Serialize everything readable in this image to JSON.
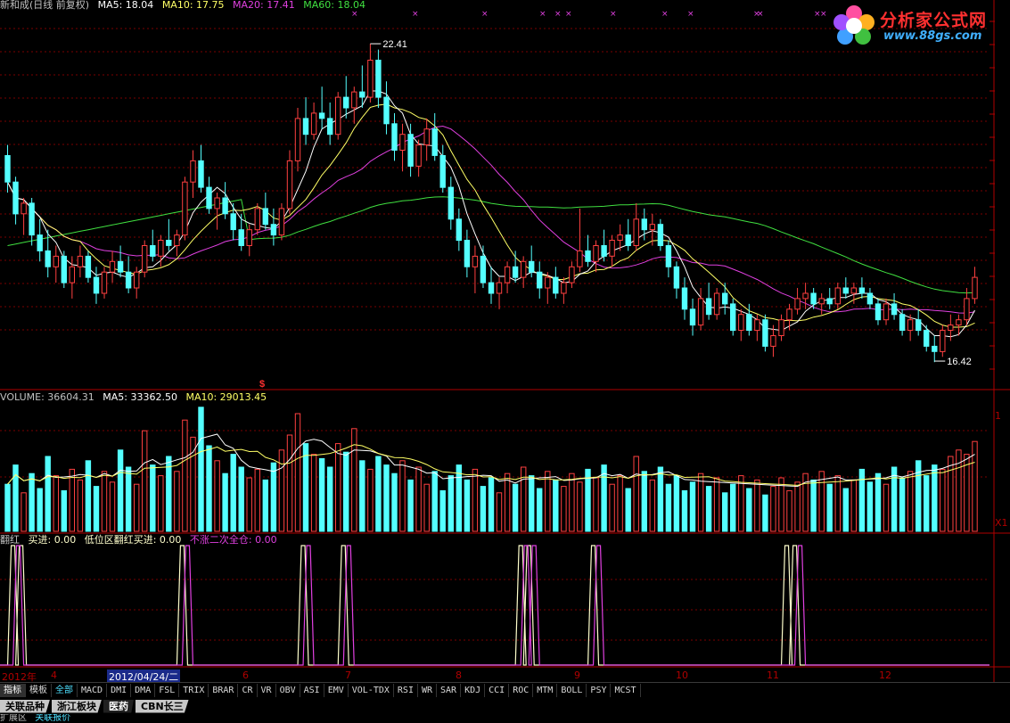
{
  "colors": {
    "up": "#ff4040",
    "down": "#54ffff",
    "ma5": "#ffffff",
    "ma10": "#ffff66",
    "ma20": "#e040e0",
    "ma60": "#40e040",
    "grid": "#7a0000",
    "divider": "#b00000",
    "signal_a": "#ffffcc",
    "signal_b": "#e040e0",
    "text": "#c0c0c0",
    "accent_cyan": "#54ffff"
  },
  "price_panel": {
    "title": "新和成(日线 前复权)",
    "ma5": "MA5: 18.04",
    "ma10": "MA10: 17.75",
    "ma20": "MA20: 17.41",
    "ma60": "MA60: 18.04",
    "high_label": "22.41",
    "low_label": "16.42",
    "marker": "$",
    "xmark": "×"
  },
  "volume_panel": {
    "title": "VOLUME: 36604.31",
    "ma5": "MA5: 33362.50",
    "ma10": "MA10: 29013.45",
    "axis_right": "1",
    "axis_unit": "X1"
  },
  "signal_panel": {
    "name": "翻红",
    "buy": "买进: 0.00",
    "low_buy": "低位区翻红买进: 0.00",
    "full": "不涨二次全仓: 0.00"
  },
  "date_axis": {
    "year_label": "2012年",
    "cursor_date": "2012/04/24/二",
    "months": [
      "4",
      "6",
      "7",
      "8",
      "9",
      "10",
      "11",
      "12"
    ]
  },
  "indicator_tabs": [
    "指标",
    "模板",
    "全部",
    "MACD",
    "DMI",
    "DMA",
    "FSL",
    "TRIX",
    "BRAR",
    "CR",
    "VR",
    "OBV",
    "ASI",
    "EMV",
    "VOL-TDX",
    "RSI",
    "WR",
    "SAR",
    "KDJ",
    "CCI",
    "ROC",
    "MTM",
    "BOLL",
    "PSY",
    "MCST"
  ],
  "block_tabs": [
    "关联品种",
    "浙江板块",
    "医药",
    "CBN长三"
  ],
  "status_text": "扩展区",
  "status_link": "关联报价",
  "watermark": {
    "title": "分析家公式网",
    "url": "www.88gs.com"
  },
  "chart_data": {
    "type": "candlestick",
    "title": "新和成(日线 前复权)",
    "price_range": [
      16.0,
      23.0
    ],
    "high": 22.41,
    "low": 16.42,
    "ohlc": [
      [
        20.3,
        20.5,
        19.6,
        19.8
      ],
      [
        19.8,
        19.9,
        19.0,
        19.2
      ],
      [
        19.2,
        19.5,
        18.8,
        19.4
      ],
      [
        19.4,
        19.5,
        18.6,
        18.8
      ],
      [
        18.8,
        19.1,
        18.3,
        18.5
      ],
      [
        18.5,
        18.9,
        18.0,
        18.2
      ],
      [
        18.2,
        18.6,
        17.9,
        18.4
      ],
      [
        18.4,
        18.5,
        17.8,
        17.9
      ],
      [
        17.9,
        18.4,
        17.6,
        18.2
      ],
      [
        18.2,
        18.6,
        18.0,
        18.4
      ],
      [
        18.4,
        18.5,
        17.9,
        18.0
      ],
      [
        18.0,
        18.2,
        17.5,
        17.7
      ],
      [
        17.7,
        18.2,
        17.6,
        18.1
      ],
      [
        18.1,
        18.5,
        17.9,
        18.3
      ],
      [
        18.3,
        18.6,
        18.0,
        18.1
      ],
      [
        18.1,
        18.4,
        17.7,
        17.8
      ],
      [
        17.8,
        18.2,
        17.6,
        18.1
      ],
      [
        18.1,
        18.7,
        18.0,
        18.6
      ],
      [
        18.6,
        18.9,
        18.3,
        18.4
      ],
      [
        18.4,
        18.8,
        18.2,
        18.7
      ],
      [
        18.7,
        19.1,
        18.5,
        18.6
      ],
      [
        18.6,
        18.9,
        18.4,
        18.8
      ],
      [
        18.8,
        19.9,
        18.7,
        19.8
      ],
      [
        19.8,
        20.4,
        19.5,
        20.2
      ],
      [
        20.2,
        20.5,
        19.6,
        19.7
      ],
      [
        19.7,
        19.9,
        19.2,
        19.3
      ],
      [
        19.3,
        19.6,
        18.9,
        19.5
      ],
      [
        19.5,
        19.8,
        19.1,
        19.2
      ],
      [
        19.2,
        19.4,
        18.7,
        18.9
      ],
      [
        18.9,
        19.2,
        18.5,
        18.6
      ],
      [
        18.6,
        19.0,
        18.4,
        18.9
      ],
      [
        18.9,
        19.4,
        18.8,
        19.3
      ],
      [
        19.3,
        19.6,
        18.9,
        19.0
      ],
      [
        19.0,
        19.3,
        18.6,
        18.8
      ],
      [
        18.8,
        19.4,
        18.7,
        19.3
      ],
      [
        19.3,
        20.4,
        19.2,
        20.2
      ],
      [
        20.2,
        21.2,
        20.0,
        21.0
      ],
      [
        21.0,
        21.4,
        20.5,
        20.7
      ],
      [
        20.7,
        21.3,
        20.6,
        21.1
      ],
      [
        21.1,
        21.6,
        20.8,
        21.0
      ],
      [
        21.0,
        21.3,
        20.5,
        20.7
      ],
      [
        20.7,
        21.5,
        20.6,
        21.4
      ],
      [
        21.4,
        21.8,
        21.0,
        21.2
      ],
      [
        21.2,
        21.6,
        20.9,
        21.5
      ],
      [
        21.5,
        22.0,
        21.2,
        21.4
      ],
      [
        21.4,
        22.41,
        21.3,
        22.1
      ],
      [
        22.1,
        22.3,
        21.2,
        21.4
      ],
      [
        21.4,
        21.7,
        20.7,
        20.9
      ],
      [
        20.9,
        21.1,
        20.2,
        20.4
      ],
      [
        20.4,
        20.9,
        20.0,
        20.7
      ],
      [
        20.7,
        20.9,
        19.9,
        20.1
      ],
      [
        20.1,
        20.6,
        19.9,
        20.5
      ],
      [
        20.5,
        21.0,
        20.2,
        20.8
      ],
      [
        20.8,
        21.1,
        20.2,
        20.3
      ],
      [
        20.3,
        20.5,
        19.6,
        19.7
      ],
      [
        19.7,
        19.9,
        18.9,
        19.1
      ],
      [
        19.1,
        19.3,
        18.5,
        18.7
      ],
      [
        18.7,
        18.9,
        18.0,
        18.2
      ],
      [
        18.2,
        18.6,
        17.7,
        18.4
      ],
      [
        18.4,
        18.6,
        17.8,
        17.9
      ],
      [
        17.9,
        18.2,
        17.5,
        17.7
      ],
      [
        17.7,
        18.0,
        17.4,
        17.9
      ],
      [
        17.9,
        18.3,
        17.7,
        18.2
      ],
      [
        18.2,
        18.5,
        17.9,
        18.0
      ],
      [
        18.0,
        18.4,
        17.8,
        18.3
      ],
      [
        18.3,
        18.6,
        18.0,
        18.1
      ],
      [
        18.1,
        18.3,
        17.6,
        17.8
      ],
      [
        17.8,
        18.1,
        17.5,
        18.0
      ],
      [
        18.0,
        18.2,
        17.6,
        17.7
      ],
      [
        17.7,
        18.0,
        17.5,
        17.9
      ],
      [
        17.9,
        18.3,
        17.8,
        18.2
      ],
      [
        18.2,
        19.3,
        18.1,
        18.5
      ],
      [
        18.5,
        18.8,
        18.2,
        18.3
      ],
      [
        18.3,
        18.7,
        18.1,
        18.6
      ],
      [
        18.6,
        18.9,
        18.3,
        18.4
      ],
      [
        18.4,
        18.8,
        18.2,
        18.7
      ],
      [
        18.7,
        19.0,
        18.5,
        18.8
      ],
      [
        18.8,
        19.1,
        18.5,
        18.6
      ],
      [
        18.6,
        19.4,
        18.5,
        19.1
      ],
      [
        19.1,
        19.3,
        18.7,
        18.9
      ],
      [
        18.9,
        19.2,
        18.6,
        19.0
      ],
      [
        19.0,
        19.1,
        18.5,
        18.6
      ],
      [
        18.6,
        18.7,
        18.0,
        18.2
      ],
      [
        18.2,
        18.3,
        17.6,
        17.8
      ],
      [
        17.8,
        18.0,
        17.2,
        17.4
      ],
      [
        17.4,
        17.6,
        16.9,
        17.1
      ],
      [
        17.1,
        17.8,
        17.0,
        17.6
      ],
      [
        17.6,
        17.9,
        17.2,
        17.3
      ],
      [
        17.3,
        17.8,
        17.2,
        17.7
      ],
      [
        17.7,
        17.9,
        17.3,
        17.5
      ],
      [
        17.5,
        17.6,
        16.9,
        17.0
      ],
      [
        17.0,
        17.4,
        16.8,
        17.3
      ],
      [
        17.3,
        17.5,
        16.9,
        17.0
      ],
      [
        17.0,
        17.3,
        16.8,
        17.2
      ],
      [
        17.2,
        17.3,
        16.6,
        16.7
      ],
      [
        16.7,
        17.1,
        16.5,
        16.9
      ],
      [
        16.9,
        17.3,
        16.8,
        17.2
      ],
      [
        17.2,
        17.5,
        17.0,
        17.4
      ],
      [
        17.4,
        17.8,
        17.3,
        17.6
      ],
      [
        17.6,
        17.9,
        17.4,
        17.7
      ],
      [
        17.7,
        17.8,
        17.4,
        17.5
      ],
      [
        17.5,
        17.7,
        17.3,
        17.6
      ],
      [
        17.6,
        17.8,
        17.4,
        17.5
      ],
      [
        17.5,
        17.9,
        17.4,
        17.8
      ],
      [
        17.8,
        18.0,
        17.6,
        17.7
      ],
      [
        17.7,
        17.9,
        17.5,
        17.8
      ],
      [
        17.8,
        18.0,
        17.6,
        17.7
      ],
      [
        17.7,
        17.8,
        17.4,
        17.5
      ],
      [
        17.5,
        17.6,
        17.1,
        17.2
      ],
      [
        17.2,
        17.6,
        17.1,
        17.5
      ],
      [
        17.5,
        17.7,
        17.2,
        17.3
      ],
      [
        17.3,
        17.4,
        16.9,
        17.0
      ],
      [
        17.0,
        17.3,
        16.8,
        17.2
      ],
      [
        17.2,
        17.4,
        16.9,
        17.0
      ],
      [
        17.0,
        17.1,
        16.6,
        16.7
      ],
      [
        16.7,
        16.9,
        16.4,
        16.6
      ],
      [
        16.6,
        17.1,
        16.5,
        17.0
      ],
      [
        17.0,
        17.3,
        16.8,
        17.1
      ],
      [
        17.1,
        17.3,
        16.9,
        17.2
      ],
      [
        17.2,
        17.8,
        17.1,
        17.6
      ],
      [
        17.6,
        18.2,
        17.5,
        18.0
      ]
    ],
    "volume": [
      22,
      31,
      18,
      27,
      20,
      35,
      26,
      19,
      29,
      24,
      33,
      21,
      28,
      23,
      38,
      30,
      22,
      47,
      31,
      26,
      35,
      28,
      52,
      44,
      58,
      40,
      33,
      27,
      36,
      30,
      25,
      29,
      24,
      32,
      38,
      45,
      55,
      41,
      36,
      34,
      30,
      41,
      37,
      48,
      33,
      29,
      35,
      31,
      27,
      33,
      24,
      30,
      22,
      28,
      19,
      26,
      31,
      24,
      29,
      21,
      25,
      18,
      27,
      22,
      30,
      26,
      20,
      28,
      24,
      21,
      27,
      23,
      29,
      25,
      31,
      22,
      26,
      20,
      35,
      28,
      24,
      30,
      22,
      26,
      19,
      23,
      27,
      21,
      25,
      18,
      22,
      26,
      20,
      24,
      17,
      21,
      25,
      19,
      23,
      27,
      24,
      28,
      22,
      26,
      20,
      24,
      29,
      23,
      27,
      22,
      30,
      25,
      28,
      33,
      26,
      31,
      29,
      35,
      38,
      36,
      42
    ],
    "signal_a_hits": [
      1,
      2,
      22,
      37,
      42,
      64,
      65,
      73,
      97,
      98
    ],
    "signal_b_hits": [
      1,
      22,
      37,
      42,
      64,
      65,
      73,
      98
    ]
  }
}
